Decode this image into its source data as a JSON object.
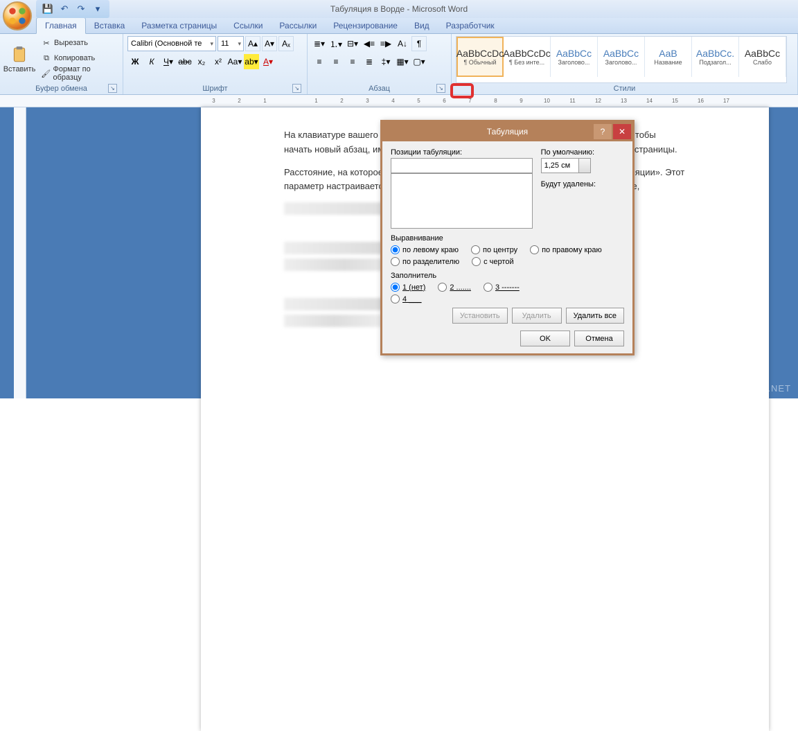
{
  "window": {
    "title": "Табуляция в Ворде - Microsoft Word"
  },
  "qat": {
    "save": "💾",
    "undo": "↶",
    "redo": "↷"
  },
  "tabs": [
    "Главная",
    "Вставка",
    "Разметка страницы",
    "Ссылки",
    "Рассылки",
    "Рецензирование",
    "Вид",
    "Разработчик"
  ],
  "ribbon": {
    "clipboard": {
      "label": "Буфер обмена",
      "paste": "Вставить",
      "cut": "Вырезать",
      "copy": "Копировать",
      "format_painter": "Формат по образцу"
    },
    "font": {
      "label": "Шрифт",
      "name": "Calibri (Основной те",
      "size": "11"
    },
    "paragraph": {
      "label": "Абзац"
    },
    "styles": {
      "label": "Стили",
      "items": [
        {
          "preview": "AaBbCcDc",
          "name": "¶ Обычный",
          "blue": false,
          "sel": true
        },
        {
          "preview": "AaBbCcDc",
          "name": "¶ Без инте...",
          "blue": false,
          "sel": false
        },
        {
          "preview": "AaBbCc",
          "name": "Заголово...",
          "blue": true,
          "sel": false
        },
        {
          "preview": "AaBbCc",
          "name": "Заголово...",
          "blue": true,
          "sel": false
        },
        {
          "preview": "AaB",
          "name": "Название",
          "blue": true,
          "sel": false
        },
        {
          "preview": "AaBbCc.",
          "name": "Подзагол...",
          "blue": true,
          "sel": false
        },
        {
          "preview": "AaBbCc",
          "name": "Слабо",
          "blue": false,
          "sel": false
        }
      ]
    }
  },
  "ruler_marks": [
    "3",
    "2",
    "1",
    "",
    "1",
    "2",
    "3",
    "4",
    "5",
    "6",
    "7",
    "8",
    "9",
    "10",
    "11",
    "12",
    "13",
    "14",
    "15",
    "16",
    "17"
  ],
  "document": {
    "p1": "На клавиатуре вашего компьютера есть клавиша Tab. Она используется для того, чтобы начать новый абзац, именно с её помощью задается определенный отступ от края страницы.",
    "p2": "Расстояние, на которое перемещается курсор при нажатии, называется «шаг табуляции». Этот параметр настраивается, и если по умолчанию стоит слишком большое расстояние,",
    "p3": "меняется в диалоге «Табуляция», она расположена",
    "p4": "при отступ – измените"
  },
  "dialog": {
    "title": "Табуляция",
    "pos_label": "Позиции табуляции:",
    "pos_value": "",
    "default_label": "По умолчанию:",
    "default_value": "1,25 см",
    "to_delete": "Будут удалены:",
    "align_label": "Выравнивание",
    "align": {
      "left": "по левому краю",
      "center": "по центру",
      "right": "по правому краю",
      "sep": "по разделителю",
      "bar": "с чертой"
    },
    "leader_label": "Заполнитель",
    "leader": {
      "none": "1 (нет)",
      "dots": "2 .......",
      "dash": "3 -------",
      "under": "4 ___"
    },
    "set": "Установить",
    "clear": "Удалить",
    "clear_all": "Удалить все",
    "ok": "OK",
    "cancel": "Отмена"
  },
  "watermark": "FREE-OFFICE.NET"
}
